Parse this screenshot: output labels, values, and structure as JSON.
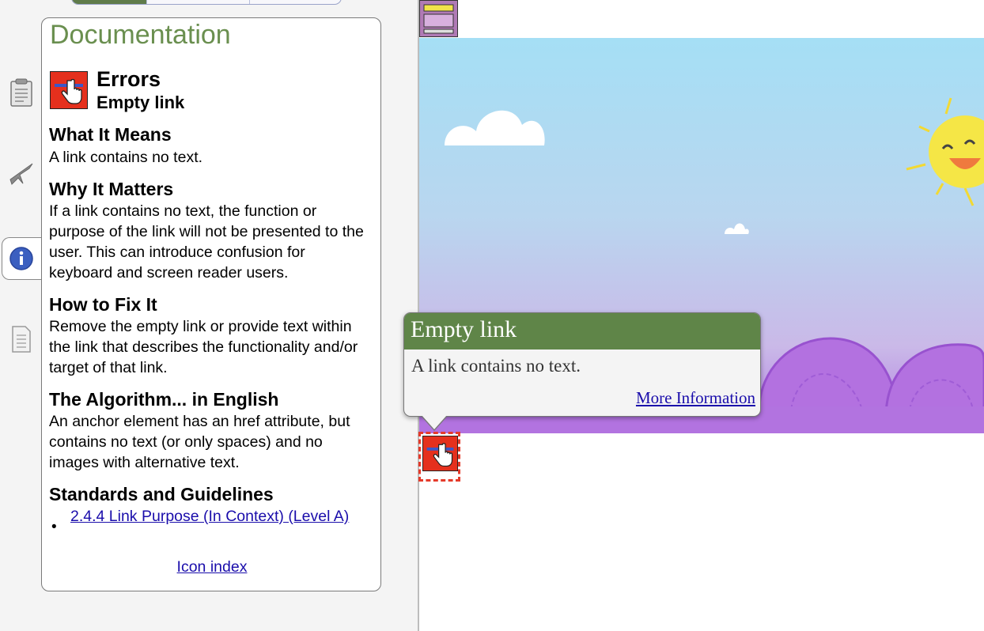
{
  "documentation": {
    "title": "Documentation",
    "category": "Errors",
    "item_name": "Empty link",
    "sections": [
      {
        "heading": "What It Means",
        "body": "A link contains no text."
      },
      {
        "heading": "Why It Matters",
        "body": "If a link contains no text, the function or purpose of the link will not be presented to the user. This can introduce confusion for keyboard and screen reader users."
      },
      {
        "heading": "How to Fix It",
        "body": "Remove the empty link or provide text within the link that describes the functionality and/or target of that link."
      },
      {
        "heading": "The Algorithm... in English",
        "body": "An anchor element has an href attribute, but contains no text (or only spaces) and no images with alternative text."
      },
      {
        "heading": "Standards and Guidelines",
        "body": ""
      }
    ],
    "standards_link": "2.4.4 Link Purpose (In Context) (Level A)",
    "icon_index_link": "Icon index"
  },
  "tooltip": {
    "title": "Empty link",
    "body": "A link contains no text.",
    "link": "More Information"
  },
  "icons": {
    "side_tabs": [
      "clipboard-icon",
      "airplane-icon",
      "info-icon",
      "document-list-icon"
    ],
    "error": "empty-link-error-icon"
  },
  "colors": {
    "doc_title": "#6a8f4f",
    "tooltip_header": "#5f8548",
    "error_red": "#e53a2a",
    "link_blue": "#1a0dab"
  }
}
